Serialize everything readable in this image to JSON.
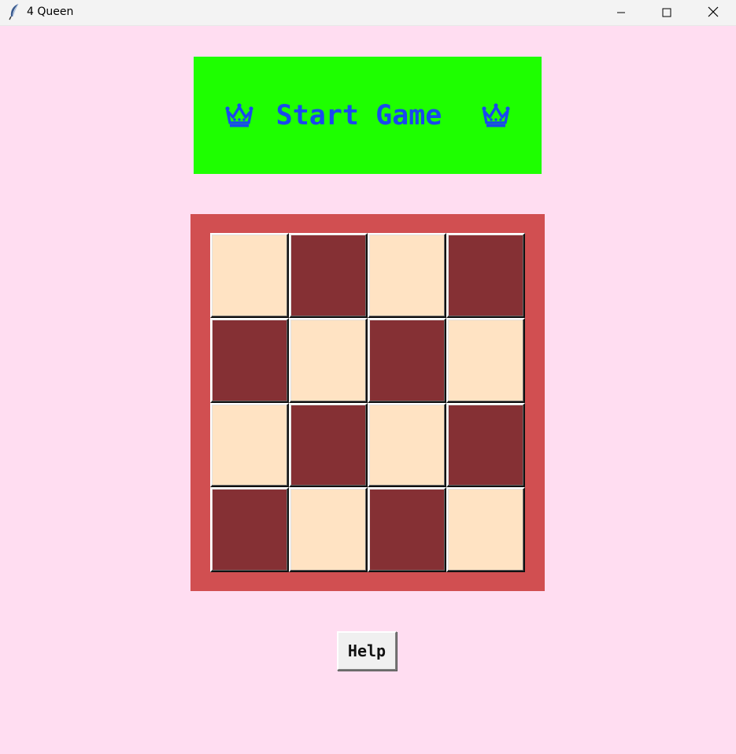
{
  "window": {
    "title": "4 Queen",
    "app_icon": "feather-icon",
    "controls": [
      "minimize-icon",
      "maximize-icon",
      "close-icon"
    ]
  },
  "start": {
    "label": "Start Game",
    "icon": "crown-icon",
    "background": "#1eff00",
    "text_color": "#1948ee"
  },
  "board": {
    "size": 4,
    "frame_color": "#d14f51",
    "light_color": "#ffe3c3",
    "dark_color": "#853034",
    "rows": [
      [
        "light",
        "dark",
        "light",
        "dark"
      ],
      [
        "dark",
        "light",
        "dark",
        "light"
      ],
      [
        "light",
        "dark",
        "light",
        "dark"
      ],
      [
        "dark",
        "light",
        "dark",
        "light"
      ]
    ]
  },
  "help": {
    "label": "Help"
  }
}
